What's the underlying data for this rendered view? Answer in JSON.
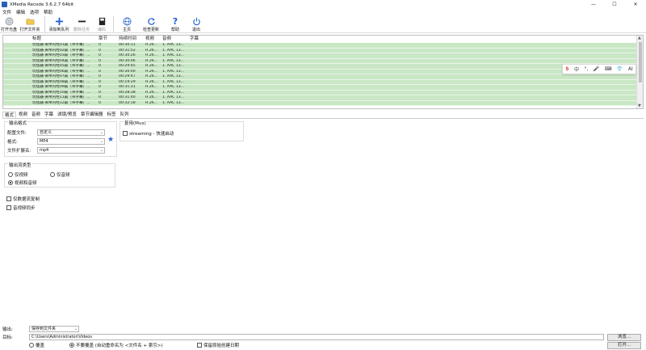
{
  "window": {
    "title": "XMedia Recode 3.6.2.7 64bit",
    "minimize": "—",
    "maximize": "☐",
    "close": "✕"
  },
  "menu": [
    "文件",
    "编辑",
    "选项",
    "帮助"
  ],
  "toolbar": {
    "open_disc": "打开光盘",
    "open_folder": "打开文件夹",
    "add_to_queue": "添加到队列",
    "remove_job": "删除任务",
    "encode": "编码",
    "home": "主页",
    "check_update": "检查更新",
    "help": "帮助",
    "exit": "退出"
  },
  "list": {
    "headers": [
      "标题",
      "章节",
      "持续时间",
      "视频",
      "音频",
      "字幕"
    ],
    "rows": [
      [
        "玩毯器-黄帝内经01篇（带字幕）...",
        "0",
        "00:30:11",
        "H.26...",
        "1. AAC  13..."
      ],
      [
        "玩毯器-黄帝内经02篇（带字幕）...",
        "0",
        "00:31:52",
        "H.26...",
        "1. AAC  13..."
      ],
      [
        "玩毯器-黄帝内经03篇（带字幕）...",
        "0",
        "00:30:26",
        "H.26...",
        "1. AAC  13..."
      ],
      [
        "玩毯器-黄帝内经04篇（带字幕）...",
        "0",
        "00:30:06",
        "H.26...",
        "1. AAC  13..."
      ],
      [
        "玩毯器-黄帝内经05篇（带字幕）...",
        "0",
        "00:29:45",
        "H.26...",
        "1. AAC  13..."
      ],
      [
        "玩毯器-黄帝内经06篇（带字幕）...",
        "0",
        "00:30:00",
        "H.26...",
        "1. AAC  13..."
      ],
      [
        "玩毯器-黄帝内经07篇（带字幕）...",
        "0",
        "00:29:47",
        "H.26...",
        "1. AAC  13..."
      ],
      [
        "玩毯器-黄帝内经08篇（带字幕）...",
        "0",
        "00:19:29",
        "H.26...",
        "1. AAC  13..."
      ],
      [
        "玩毯器-黄帝内经09篇（带字幕）...",
        "0",
        "00:31:31",
        "H.26...",
        "1. AAC  13..."
      ],
      [
        "玩毯器-黄帝内经10篇（带字幕）...",
        "0",
        "00:28:38",
        "H.26...",
        "1. AAC  13..."
      ],
      [
        "玩毯器-黄帝内经11篇（带字幕）...",
        "0",
        "00:31:40",
        "H.26...",
        "1. AAC  13..."
      ],
      [
        "玩毯器-黄帝内经12篇（带字幕）...",
        "0",
        "00:32:18",
        "H.26...",
        "1. AAC  13..."
      ]
    ]
  },
  "ime": [
    "S",
    "中",
    "°,",
    "🎤",
    "⌨",
    "👕",
    "AI"
  ],
  "tabs": [
    "格式",
    "视频",
    "音频",
    "字幕",
    "滤镜/预览",
    "章节编辑器",
    "标签",
    "队列"
  ],
  "format": {
    "output_format_title": "输出格式",
    "profile_label": "配置文件:",
    "profile_value": "自定义",
    "format_label": "格式:",
    "format_value": "MP4",
    "ext_label": "文件扩展名:",
    "ext_value": "mp4",
    "mux_title": "复用(Mux)",
    "streaming_label": "streaming - 快速启动",
    "stream_type_title": "输出流类型",
    "video_only": "仅视频",
    "audio_only": "仅音频",
    "video_audio": "视频和音频",
    "copy_data": "仅数据流复制",
    "sync": "音视频同步"
  },
  "bottom": {
    "output_label": "输出:",
    "output_value": "保存到文件夹",
    "target_label": "目标:",
    "target_value": "C:\\Users\\Administrator\\Videos",
    "browse": "浏览...",
    "overwrite": "覆盖",
    "no_overwrite": "不要覆盖 (自动重命名为 <文件名 + 索引>)",
    "keep_date": "保留原始创建日期",
    "open": "打开..."
  }
}
